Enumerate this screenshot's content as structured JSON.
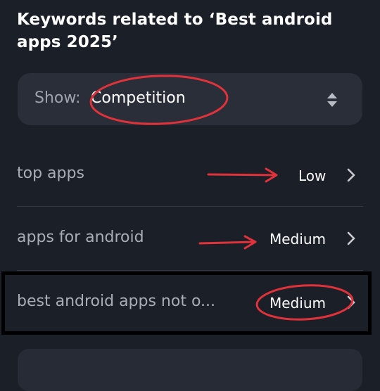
{
  "heading": "Keywords related to ‘Best android apps 2025’",
  "show_select": {
    "prefix": "Show:",
    "value": "Competition",
    "icon": "sort-up-down-icon"
  },
  "keywords": [
    {
      "keyword": "top apps",
      "competition": "Low"
    },
    {
      "keyword": "apps for android",
      "competition": "Medium"
    },
    {
      "keyword": "best android apps not o...",
      "competition": "Medium"
    }
  ],
  "colors": {
    "background": "#1b1f28",
    "card": "#292e38",
    "muted_text": "#a9adb5",
    "annotation_red": "#e0323a"
  }
}
